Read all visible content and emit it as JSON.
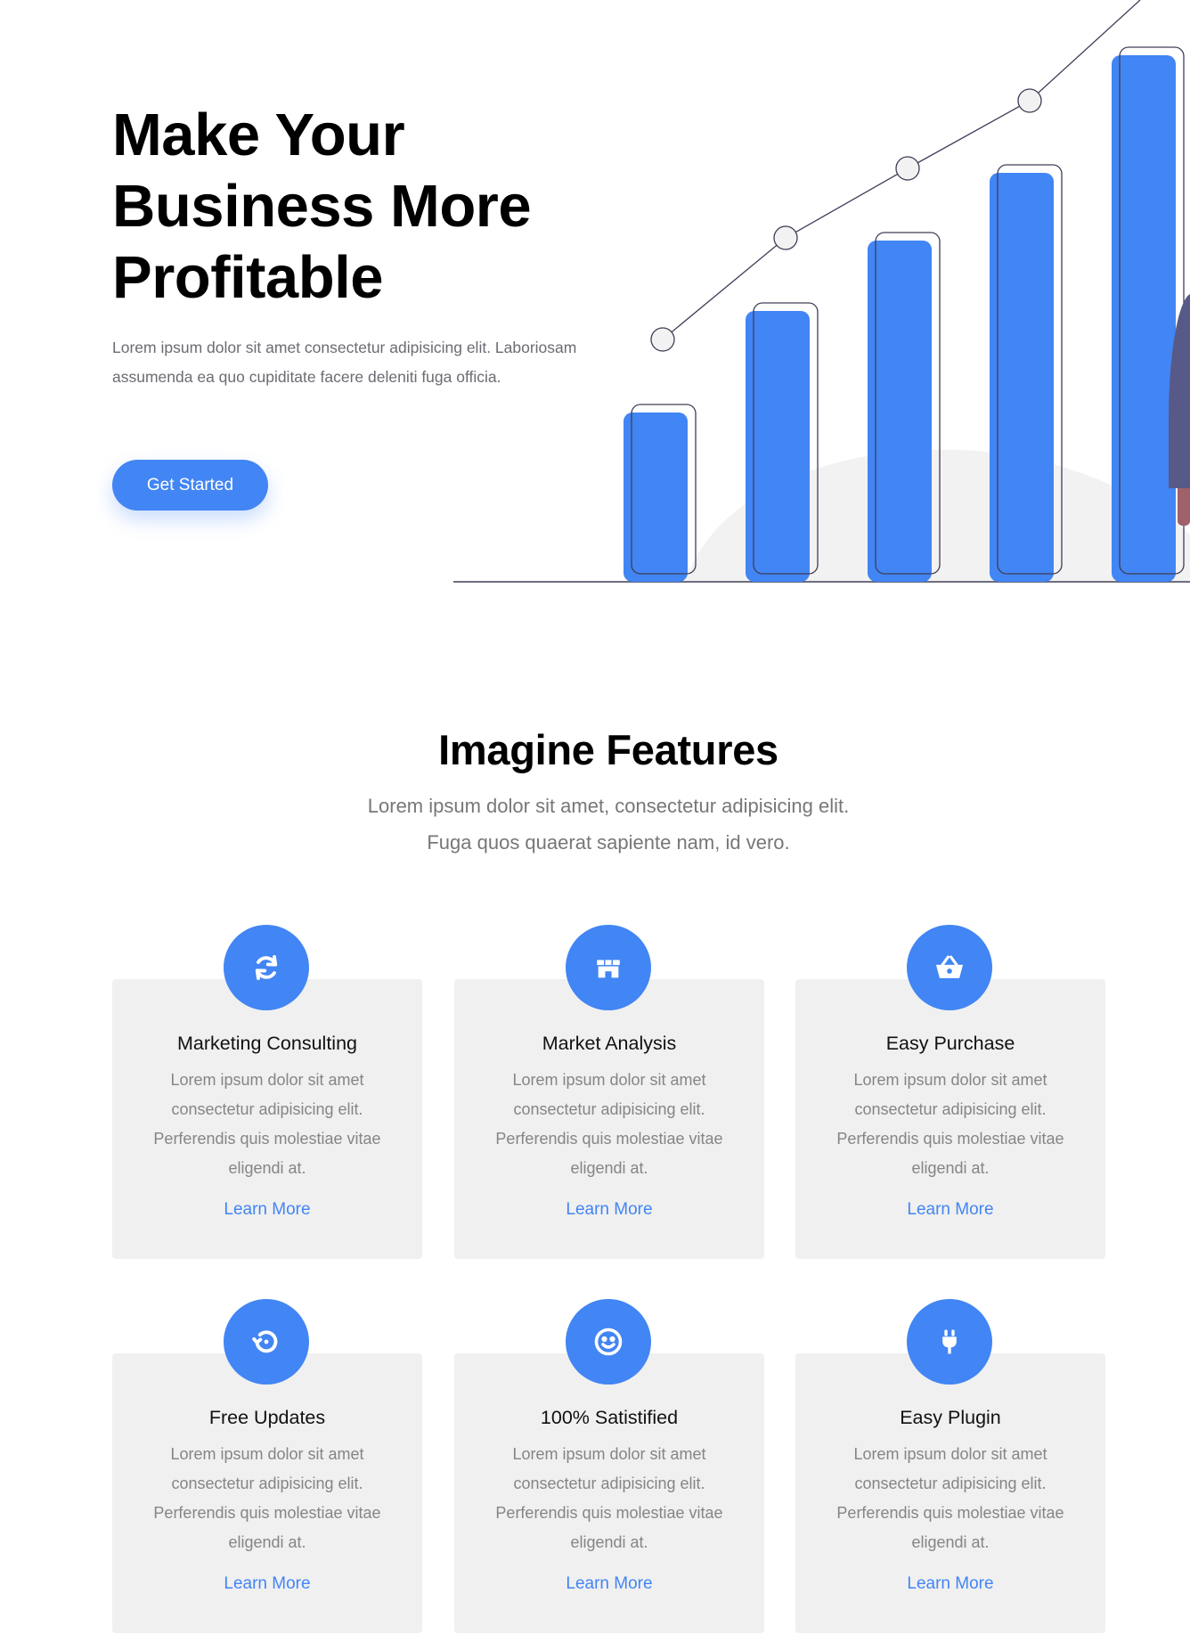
{
  "hero": {
    "title_lines": [
      "Make Your",
      "Business More",
      "Profitable"
    ],
    "description": "Lorem ipsum dolor sit amet consectetur adipisicing elit. Laboriosam assumenda ea quo cupiditate facere deleniti fuga officia.",
    "cta_label": "Get Started",
    "accent_color": "#4285f4"
  },
  "features": {
    "title": "Imagine Features",
    "subtitle_lines": [
      "Lorem ipsum dolor sit amet, consectetur adipisicing elit.",
      "Fuga quos quaerat sapiente nam, id vero."
    ],
    "cards": [
      {
        "icon": "sync-icon",
        "title": "Marketing Consulting",
        "description": "Lorem ipsum dolor sit amet consectetur adipisicing elit. Perferendis quis molestiae vitae eligendi at.",
        "link": "Learn More"
      },
      {
        "icon": "store-icon",
        "title": "Market Analysis",
        "description": "Lorem ipsum dolor sit amet consectetur adipisicing elit. Perferendis quis molestiae vitae eligendi at.",
        "link": "Learn More"
      },
      {
        "icon": "basket-icon",
        "title": "Easy Purchase",
        "description": "Lorem ipsum dolor sit amet consectetur adipisicing elit. Perferendis quis molestiae vitae eligendi at.",
        "link": "Learn More"
      },
      {
        "icon": "history-icon",
        "title": "Free Updates",
        "description": "Lorem ipsum dolor sit amet consectetur adipisicing elit. Perferendis quis molestiae vitae eligendi at.",
        "link": "Learn More"
      },
      {
        "icon": "smile-icon",
        "title": "100% Satistified",
        "description": "Lorem ipsum dolor sit amet consectetur adipisicing elit. Perferendis quis molestiae vitae eligendi at.",
        "link": "Learn More"
      },
      {
        "icon": "plug-icon",
        "title": "Easy Plugin",
        "description": "Lorem ipsum dolor sit amet consectetur adipisicing elit. Perferendis quis molestiae vitae eligendi at.",
        "link": "Learn More"
      }
    ]
  }
}
